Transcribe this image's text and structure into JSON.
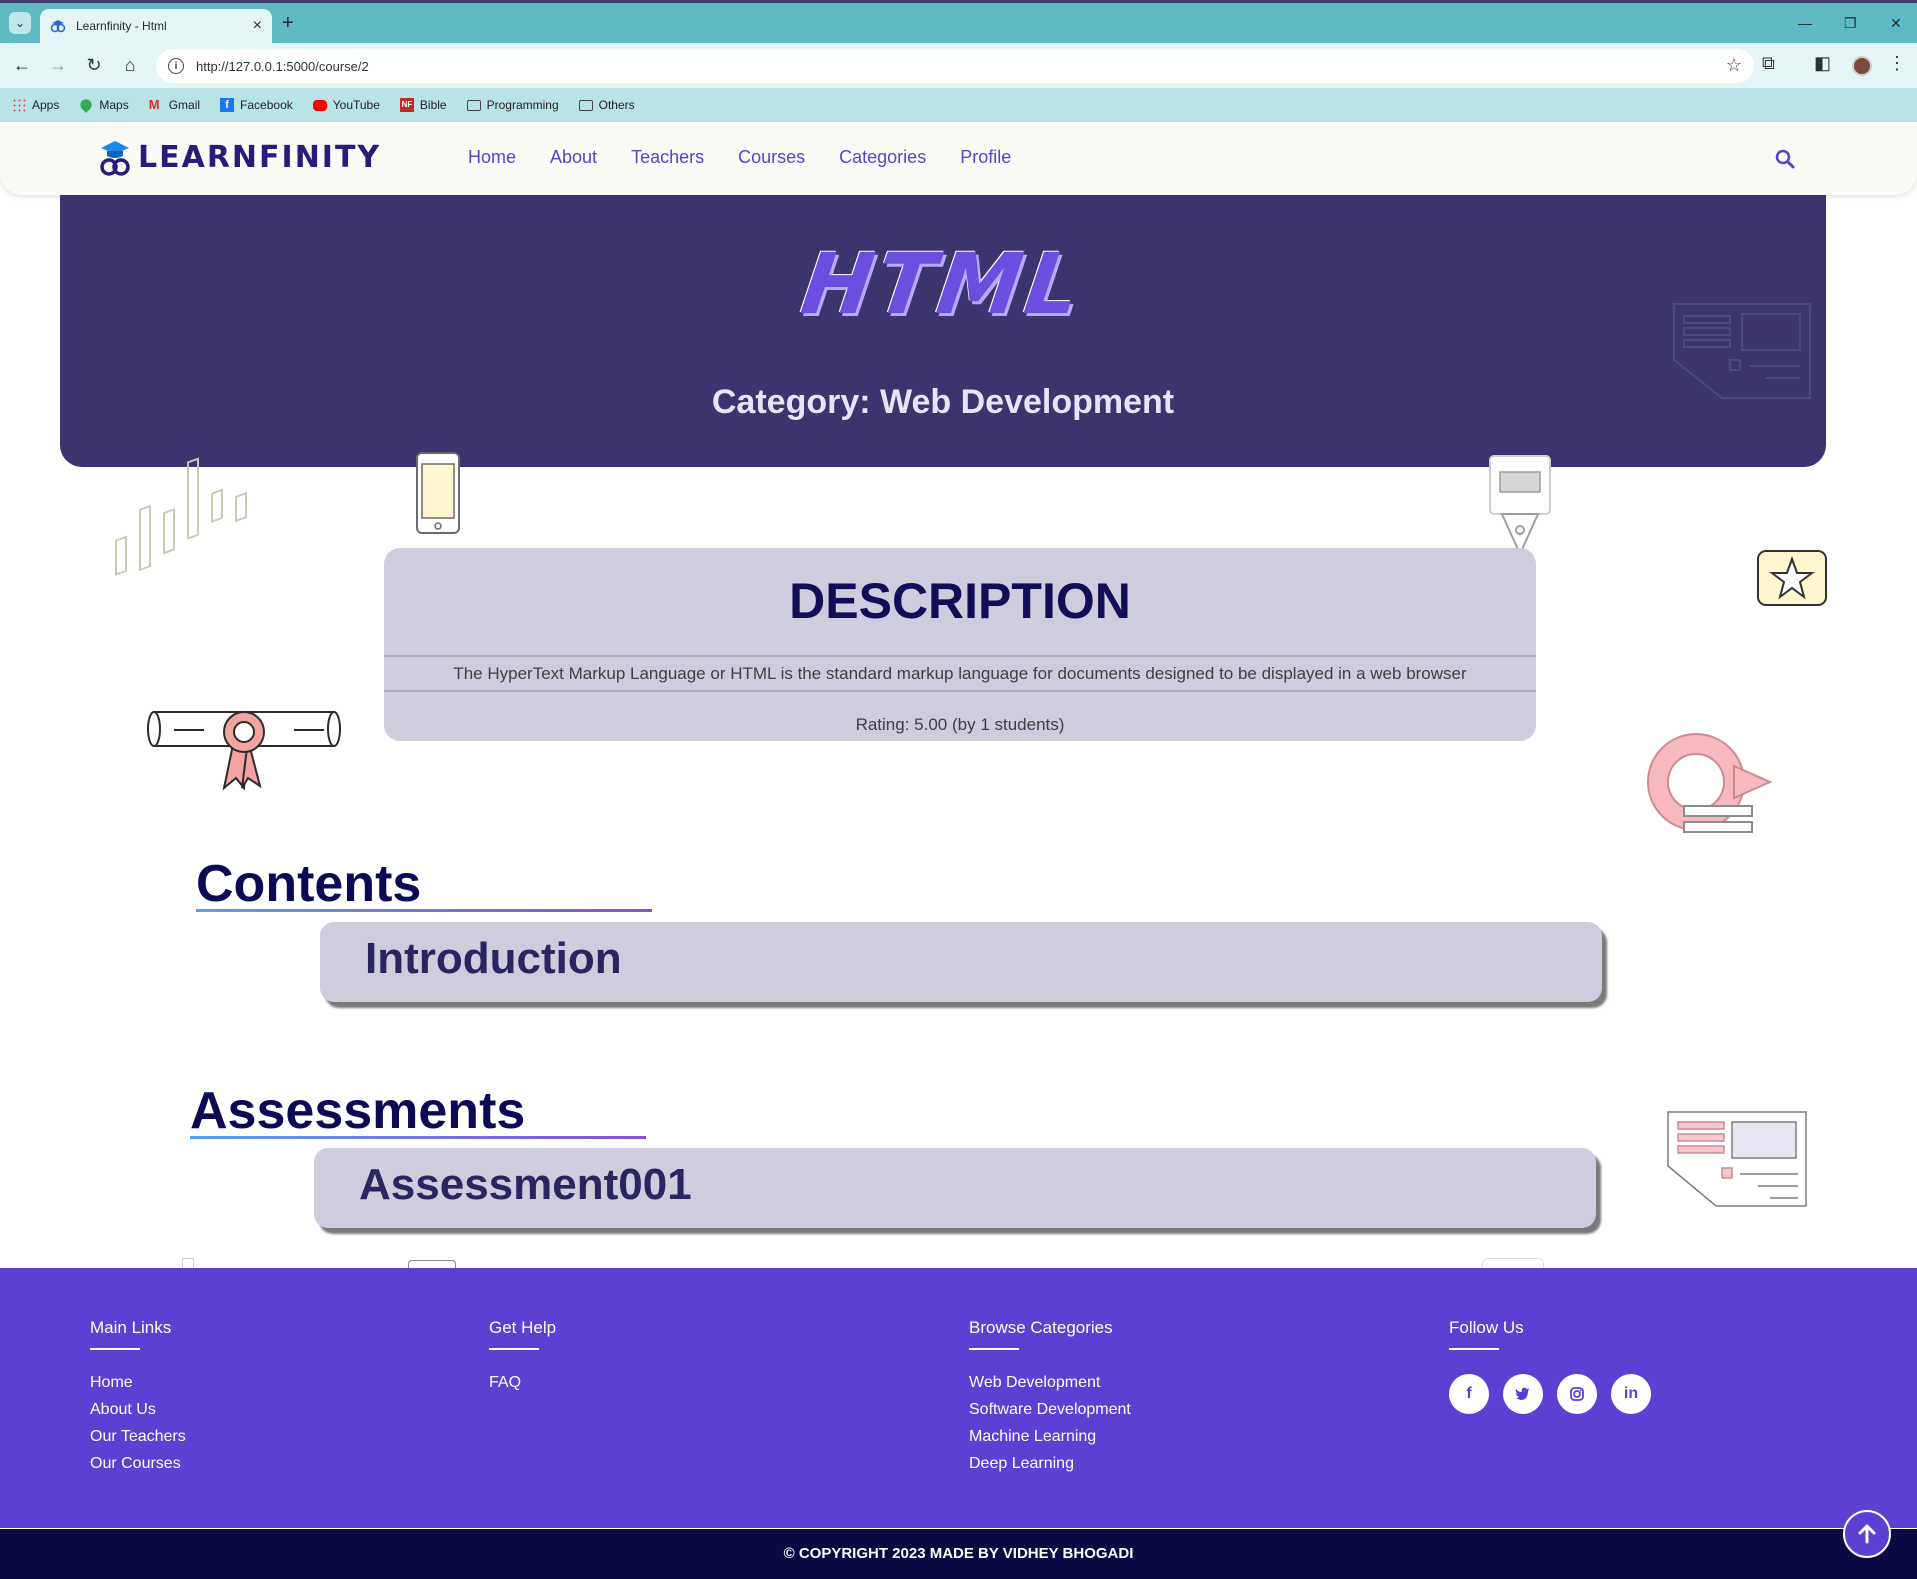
{
  "browser": {
    "tab_title": "Learnfinity - Html",
    "url": "http://127.0.0.1:5000/course/2",
    "bookmarks": [
      "Apps",
      "Maps",
      "Gmail",
      "Facebook",
      "YouTube",
      "Bible",
      "Programming",
      "Others"
    ]
  },
  "site": {
    "brand": "LEARNFINITY",
    "nav": [
      "Home",
      "About",
      "Teachers",
      "Courses",
      "Categories",
      "Profile"
    ],
    "accent": "#5d3fd4",
    "hero_bg": "#3b346e"
  },
  "course": {
    "title": "HTML",
    "category": "Category: Web Development",
    "description_heading": "DESCRIPTION",
    "description": "The HyperText Markup Language or HTML is the standard markup language for documents designed to be displayed in a web browser",
    "rating": "Rating: 5.00 (by 1 students)"
  },
  "contents": {
    "heading": "Contents",
    "items": [
      "Introduction"
    ]
  },
  "assessments": {
    "heading": "Assessments",
    "items": [
      "Assessment001"
    ]
  },
  "footer": {
    "main_links": {
      "heading": "Main Links",
      "links": [
        "Home",
        "About Us",
        "Our Teachers",
        "Our Courses"
      ]
    },
    "get_help": {
      "heading": "Get Help",
      "links": [
        "FAQ"
      ]
    },
    "browse": {
      "heading": "Browse Categories",
      "links": [
        "Web Development",
        "Software Development",
        "Machine Learning",
        "Deep Learning"
      ]
    },
    "follow": {
      "heading": "Follow Us",
      "icons": [
        "facebook-icon",
        "twitter-icon",
        "instagram-icon",
        "linkedin-icon"
      ]
    },
    "copyright": "© COPYRIGHT 2023 MADE BY VIDHEY BHOGADI"
  }
}
